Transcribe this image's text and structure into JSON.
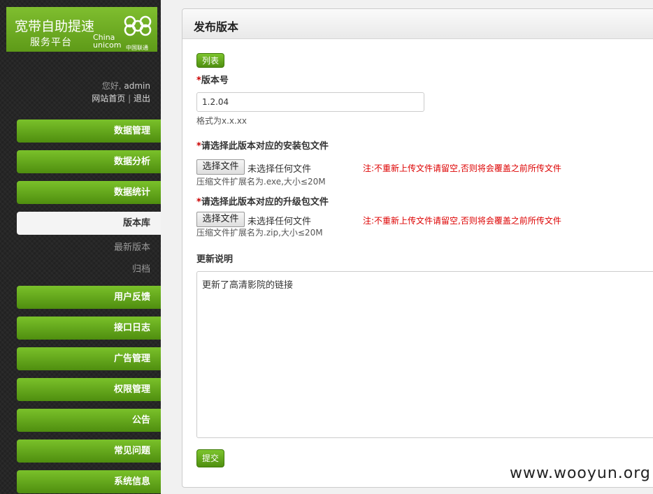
{
  "brand": {
    "title_line1": "宽带自助提速",
    "title_line2": "服务平台",
    "logo_china": "China",
    "logo_unicom": "unicom",
    "logo_cn": "中国联通",
    "logo_color": "#6aa821"
  },
  "user": {
    "greeting": "您好,",
    "name": "admin",
    "home_link": "网站首页",
    "separator": "|",
    "logout_link": "退出"
  },
  "nav": {
    "data_manage": "数据管理",
    "data_analysis": "数据分析",
    "data_stats": "数据统计",
    "version_lib": "版本库",
    "latest_version": "最新版本",
    "archive": "归档",
    "feedback": "用户反馈",
    "api_log": "接口日志",
    "ads": "广告管理",
    "permissions": "权限管理",
    "notice": "公告",
    "faq": "常见问题",
    "system_info": "系统信息",
    "accent_color": "#5fa31b"
  },
  "form": {
    "title": "发布版本",
    "list_button": "列表",
    "required_mark": "*",
    "version_label": "版本号",
    "version_value": "1.2.04",
    "version_hint": "格式为x.x.xx",
    "install_label": "请选择此版本对应的安装包文件",
    "choose_file": "选择文件",
    "no_file": "未选择任何文件",
    "install_hint": "压缩文件扩展名为.exe,大小≤20M",
    "upgrade_label": "请选择此版本对应的升级包文件",
    "upgrade_hint": "压缩文件扩展名为.zip,大小≤20M",
    "warning": "注:不重新上传文件请留空,否则将会覆盖之前所传文件",
    "notes_label": "更新说明",
    "notes_value": "更新了高清影院的链接",
    "submit_button": "提交"
  },
  "watermark": "www.wooyun.org"
}
